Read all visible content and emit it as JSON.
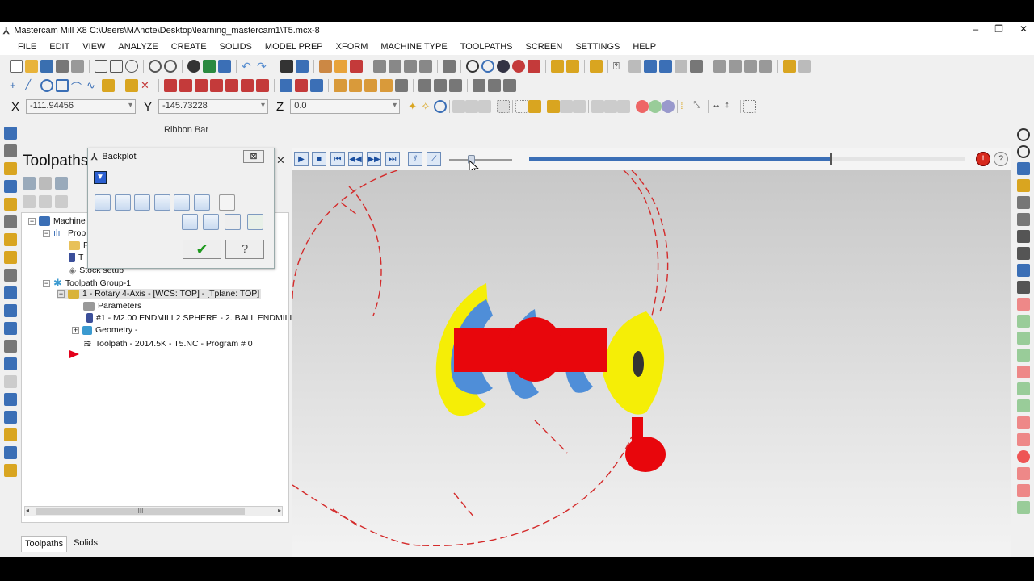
{
  "window": {
    "title": "Mastercam Mill X8  C:\\Users\\MAnote\\Desktop\\learning_mastercam1\\T5.mcx-8",
    "controls": [
      "–",
      "❐",
      "✕"
    ]
  },
  "menu": [
    "FILE",
    "EDIT",
    "VIEW",
    "ANALYZE",
    "CREATE",
    "SOLIDS",
    "MODEL PREP",
    "XFORM",
    "MACHINE TYPE",
    "TOOLPATHS",
    "SCREEN",
    "SETTINGS",
    "HELP"
  ],
  "coords": {
    "x_label": "X",
    "x_value": "-111.94456",
    "y_label": "Y",
    "y_value": "-145.73228",
    "z_label": "Z",
    "z_value": "0.0"
  },
  "ribbon_bar_label": "Ribbon Bar",
  "manager": {
    "title": "Toolpaths",
    "close": "✕",
    "tree": {
      "machine": "Machine",
      "properties": "Prop",
      "files": "F",
      "tool": "T",
      "stock_setup": "Stock setup",
      "group": "Toolpath Group-1",
      "operation": "1 - Rotary 4-Axis - [WCS: TOP] - [Tplane: TOP]",
      "parameters": "Parameters",
      "tool_line": "#1 - M2.00 ENDMILL2 SPHERE - 2. BALL ENDMILL",
      "geometry": "Geometry -",
      "toolpath": "Toolpath - 2014.5K - T5.NC - Program # 0"
    },
    "scroll_grip": "III",
    "tabs": [
      "Toolpaths",
      "Solids"
    ]
  },
  "backplot": {
    "title": "Backplot",
    "close": "⊠",
    "ok": "✔",
    "help": "?"
  },
  "playbar": {
    "slider_fraction": 0.35,
    "progress_fraction": 0.69
  },
  "colors": {
    "stock_red": "#e8060c",
    "pass_blue": "#4f8ed8",
    "pass_yellow": "#f5ee06",
    "toolpath_red": "#d42a2a"
  }
}
